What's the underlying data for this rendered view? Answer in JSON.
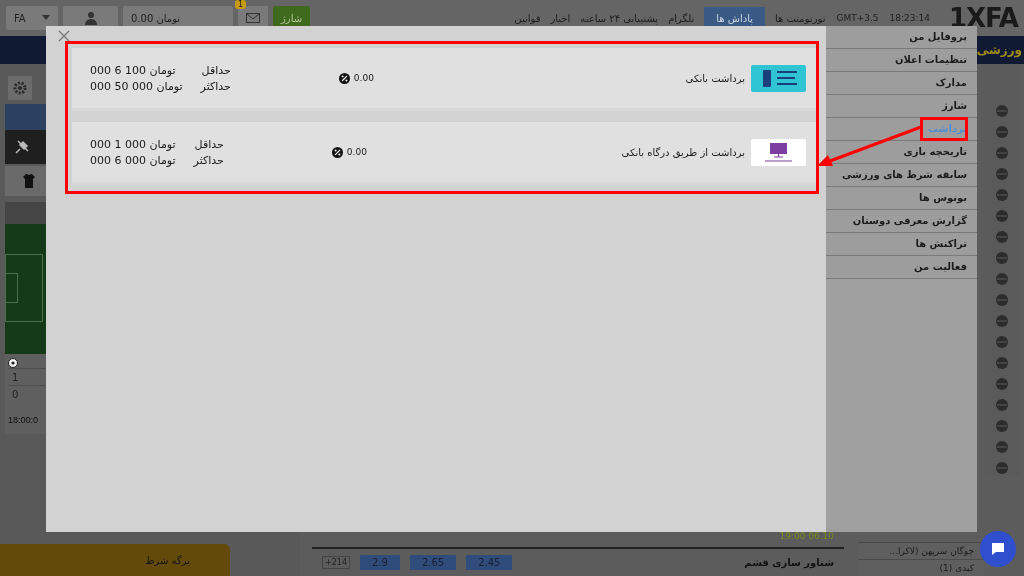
{
  "top_bar": {
    "language": "FA",
    "balance": "0.00 تومان",
    "messages_badge": "1",
    "deposit_button": "شارژ",
    "links": [
      {
        "label": "تورنومنت ها",
        "selected": false
      },
      {
        "label": "پاداش ها",
        "selected": true
      },
      {
        "label": "تلگرام",
        "selected": false
      },
      {
        "label": "پشتیبانی ۲۴ ساعته",
        "selected": false
      },
      {
        "label": "اخبار",
        "selected": false
      },
      {
        "label": "قوانین",
        "selected": false
      }
    ],
    "timezone": "GMT+3.5",
    "time": "18:23:14",
    "logo": "1XFA"
  },
  "nav_bar": {
    "section": "ورزشی"
  },
  "live_panel": {
    "score_rows": [
      "1",
      "0"
    ],
    "start_time": "18:00:0"
  },
  "events": {
    "date": "19:00 06.10",
    "match": "شناور سازی قشم",
    "odds": [
      "2.45",
      "2.65",
      "2.9"
    ],
    "more": "+214"
  },
  "sports_list": [
    {
      "name": "چوگان سرپهن (لاکرا..."
    },
    {
      "name": "کبدی (1)"
    }
  ],
  "bet_slip": {
    "title": "برگه شرط"
  },
  "modal": {
    "methods": [
      {
        "kind": "bank",
        "name": "برداشت بانکی",
        "fee": "0.00",
        "min_label": "حداقل",
        "min": "000 6 100 تومان",
        "max_label": "حداکثر",
        "max": "000 50 000 تومان"
      },
      {
        "kind": "gateway",
        "name": "برداشت از طریق درگاه بانکی",
        "fee": "0.00",
        "min_label": "حداقل",
        "min": "000 1 000 تومان",
        "max_label": "حداکثر",
        "max": "000 6 000 تومان"
      }
    ]
  },
  "account_menu": [
    {
      "label": "پروفایل من",
      "selected": false
    },
    {
      "label": "تنظیمات اعلان",
      "selected": false
    },
    {
      "label": "مدارک",
      "selected": false
    },
    {
      "label": "شارژ",
      "selected": false
    },
    {
      "label": "برداشت",
      "selected": true
    },
    {
      "label": "تاریخچه بازی",
      "selected": false
    },
    {
      "label": "سابقه شرط های ورزشی",
      "selected": false
    },
    {
      "label": "بونوس ها",
      "selected": false
    },
    {
      "label": "گزارش معرفی دوستان",
      "selected": false
    },
    {
      "label": "تراکنش ها",
      "selected": false
    },
    {
      "label": "فعالیت من",
      "selected": false
    }
  ]
}
